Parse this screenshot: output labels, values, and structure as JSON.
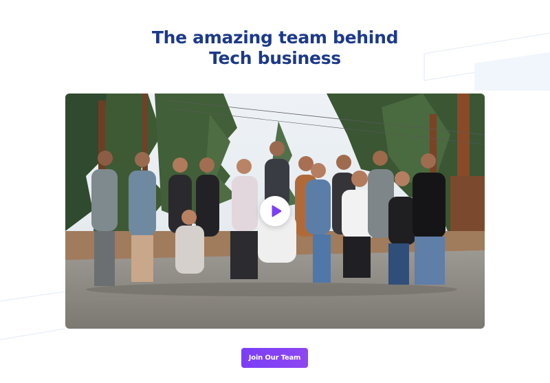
{
  "section": {
    "title_line1": "The amazing team behind",
    "title_line2": "Tech business"
  },
  "video": {
    "play_icon": "play-icon",
    "accent_color": "#7b3ff6"
  },
  "cta": {
    "label": "Join Our Team",
    "color": "#7b3ff6"
  },
  "colors": {
    "heading": "#1c3a8a",
    "background": "#ffffff"
  }
}
